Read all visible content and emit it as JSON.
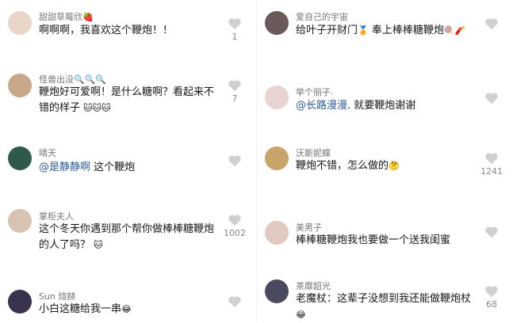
{
  "left": [
    {
      "user": "甜甜草莓欣🍓",
      "text": "啊啊啊，我喜欢这个鞭炮！！",
      "likes": "1",
      "avatar_color": "#e9d6c9"
    },
    {
      "user": "怪兽出没🔍🔍🔍",
      "text": "鞭炮好可爱啊！是什么糖啊？看起来不错的样子",
      "emoji": "🐱🐱🐱",
      "likes": "7",
      "avatar_color": "#c7a98a"
    },
    {
      "user": "晴天",
      "mention": "@是静静啊",
      "text": " 这个鞭炮",
      "likes": "",
      "avatar_color": "#2f5a4a"
    },
    {
      "user": "掌柜夫人",
      "text": "这个冬天你遇到那个帮你做棒棒糖鞭炮的人了吗？",
      "emoji": "🐱",
      "likes": "1002",
      "avatar_color": "#d8c3b2"
    },
    {
      "user": "Sun 煊赫",
      "text": "小白这糖给我一串",
      "emoji": "😂",
      "likes": "",
      "avatar_color": "#3a3350"
    }
  ],
  "right": [
    {
      "user": "爱自己的宇宙",
      "text": "给叶子开财门",
      "emoji_mid": "🏅",
      "text2": "奉上棒棒糖鞭炮",
      "emoji": "🍭🧨",
      "likes": "",
      "avatar_color": "#6b5a5a"
    },
    {
      "user": "举个丽子.",
      "mention": "@长路漫漫",
      "text": ". 就要鞭炮谢谢",
      "likes": "",
      "avatar_color": "#e8d2d2"
    },
    {
      "user": "沃斯妮蝶",
      "text": "鞭炮不错，怎么做的",
      "emoji": "🤔",
      "likes": "1241",
      "avatar_color": "#c9a46a"
    },
    {
      "user": "美男子",
      "text": "棒棒糖鞭炮我也要做一个送我闺蜜",
      "likes": "",
      "avatar_color": "#e2c9c0"
    },
    {
      "user": "茶靡韶光",
      "text": "老魔杖：这辈子没想到我还能做鞭炮杖",
      "emoji": "😂",
      "likes": "68",
      "avatar_color": "#4a4a5e"
    }
  ],
  "icons": {
    "like": "heart-outline-icon",
    "heart_color": "#c8c8c8"
  }
}
